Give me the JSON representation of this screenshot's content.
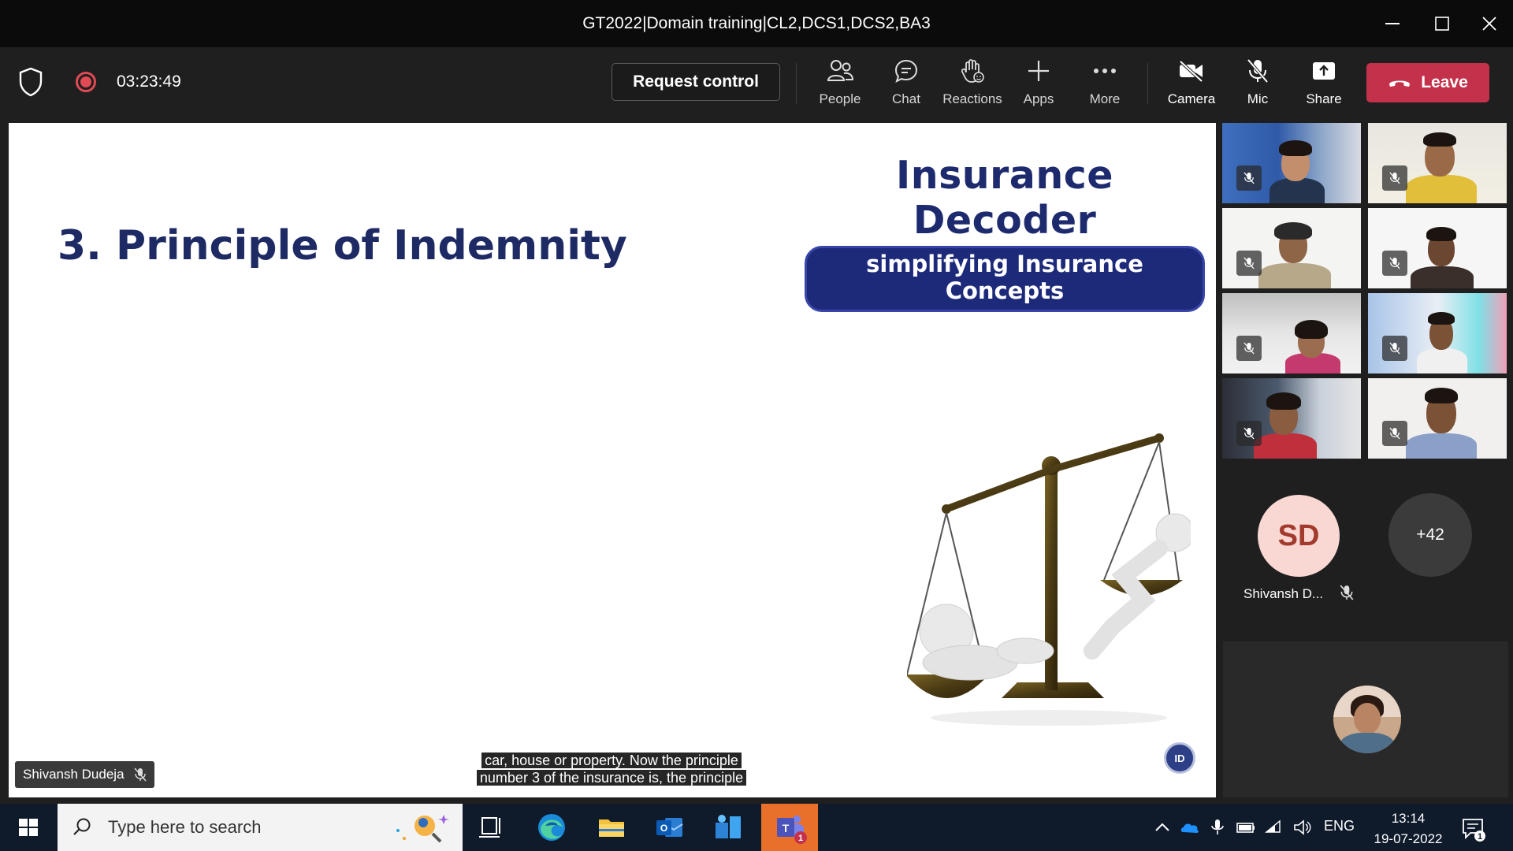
{
  "window": {
    "title": "GT2022|Domain training|CL2,DCS1,DCS2,BA3",
    "minimize": "—",
    "maximize": "☐",
    "close": "✕"
  },
  "meeting": {
    "timer": "03:23:49",
    "request_control": "Request control",
    "buttons": {
      "people": "People",
      "chat": "Chat",
      "reactions": "Reactions",
      "apps": "Apps",
      "more": "More",
      "camera": "Camera",
      "mic": "Mic",
      "share": "Share"
    },
    "leave": "Leave"
  },
  "slide": {
    "title": "3. Principle of Indemnity",
    "brand_name": "Insurance Decoder",
    "brand_tagline": "simplifying Insurance Concepts",
    "badge": "ID"
  },
  "presenter": {
    "name": "Shivansh Dudeja"
  },
  "caption": {
    "line1": "car, house or property. Now the principle",
    "line2": "number 3 of the insurance is, the principle"
  },
  "participants": {
    "sd_initials": "SD",
    "sd_name": "Shivansh D...",
    "overflow": "+42"
  },
  "taskbar": {
    "search_placeholder": "Type here to search",
    "language": "ENG",
    "time": "13:14",
    "date": "19-07-2022",
    "teams_badge": "1",
    "notification_count": "1"
  },
  "colors": {
    "leave": "#c4314b",
    "record": "#e04a54",
    "slide_title": "#1e2a63",
    "teams_active": "#e8702a"
  }
}
